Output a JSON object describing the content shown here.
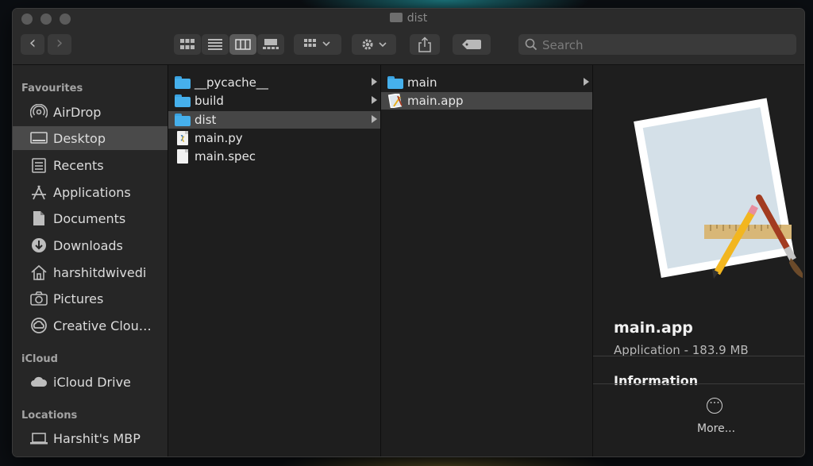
{
  "window": {
    "title": "dist"
  },
  "toolbar": {
    "back": "‹",
    "forward": "›",
    "search_placeholder": "Search"
  },
  "sidebar": {
    "favourites_title": "Favourites",
    "favourites": [
      {
        "label": "AirDrop",
        "icon": "airdrop-icon"
      },
      {
        "label": "Desktop",
        "icon": "desktop-icon",
        "selected": true
      },
      {
        "label": "Recents",
        "icon": "recents-icon"
      },
      {
        "label": "Applications",
        "icon": "applications-icon"
      },
      {
        "label": "Documents",
        "icon": "documents-icon"
      },
      {
        "label": "Downloads",
        "icon": "downloads-icon"
      },
      {
        "label": "harshitdwivedi",
        "icon": "home-icon"
      },
      {
        "label": "Pictures",
        "icon": "pictures-icon"
      },
      {
        "label": "Creative Clou…",
        "icon": "creative-cloud-icon"
      }
    ],
    "icloud_title": "iCloud",
    "icloud": [
      {
        "label": "iCloud Drive",
        "icon": "icloud-icon"
      }
    ],
    "locations_title": "Locations",
    "locations": [
      {
        "label": "Harshit's MBP",
        "icon": "laptop-icon"
      }
    ]
  },
  "column1": [
    {
      "label": "__pycache__",
      "type": "folder",
      "has_children": true
    },
    {
      "label": "build",
      "type": "folder",
      "has_children": true
    },
    {
      "label": "dist",
      "type": "folder",
      "has_children": true,
      "selected": true
    },
    {
      "label": "main.py",
      "type": "python-file"
    },
    {
      "label": "main.spec",
      "type": "file"
    }
  ],
  "column2": [
    {
      "label": "main",
      "type": "folder",
      "has_children": true
    },
    {
      "label": "main.app",
      "type": "app",
      "selected": true
    }
  ],
  "preview": {
    "name": "main.app",
    "kind": "Application - 183.9 MB",
    "info_heading": "Information",
    "more_label": "More..."
  },
  "colors": {
    "folder_blue": "#46b0ec",
    "selection": "#464646",
    "sidebar_selection": "#4a4a4a"
  }
}
